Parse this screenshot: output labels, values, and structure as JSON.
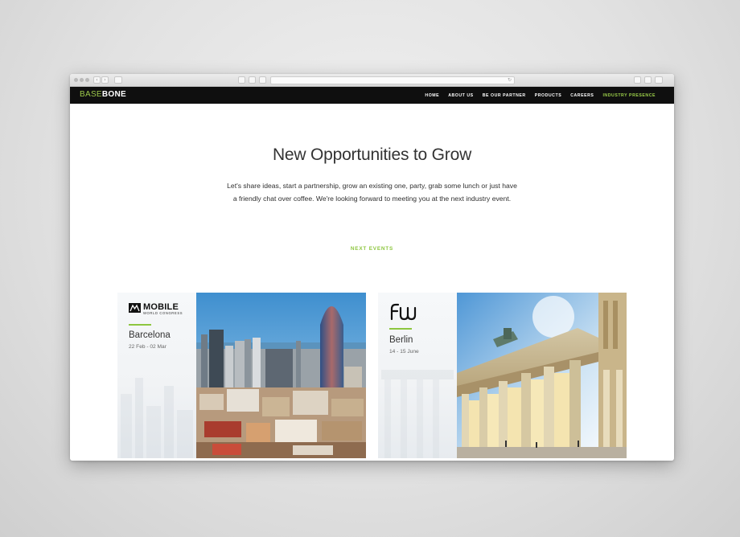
{
  "browser": {
    "back_symbol": "‹",
    "forward_symbol": "›",
    "reload_symbol": "↻"
  },
  "nav": {
    "logo_part1": "BASE",
    "logo_part2": "BONE",
    "items": [
      {
        "label": "HOME",
        "active": false
      },
      {
        "label": "ABOUT US",
        "active": false
      },
      {
        "label": "BE OUR PARTNER",
        "active": false
      },
      {
        "label": "PRODUCTS",
        "active": false
      },
      {
        "label": "CAREERS",
        "active": false
      },
      {
        "label": "INDUSTRY PRESENCE",
        "active": true
      }
    ]
  },
  "hero": {
    "title": "New Opportunities to Grow",
    "intro_line1": "Let's share ideas, start a partnership, grow an existing one, party, grab some lunch or just have",
    "intro_line2": "a friendly chat over coffee. We're looking forward to meeting you at the next industry event."
  },
  "events": {
    "section_label": "NEXT EVENTS",
    "items": [
      {
        "logo_line1": "MOBILE",
        "logo_line2": "WORLD CONGRESS",
        "city": "Barcelona",
        "dates": "22 Feb - 02 Mar"
      },
      {
        "city": "Berlin",
        "dates": "14 - 15 June"
      }
    ]
  },
  "colors": {
    "accent": "#8dc63f",
    "nav_background": "#0f0f0f",
    "active_nav": "#9cd04a"
  }
}
